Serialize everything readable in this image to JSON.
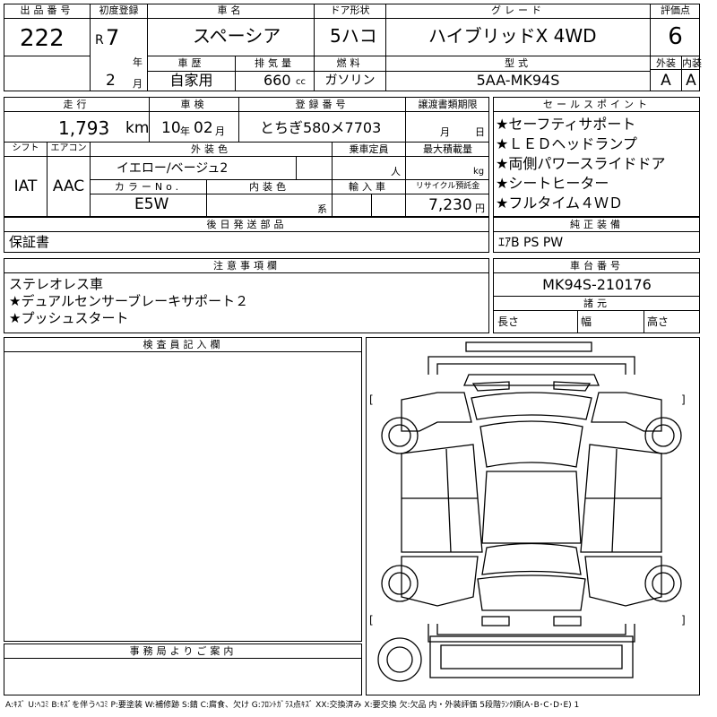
{
  "header": {
    "lot_label": "出品番号",
    "lot_value": "222",
    "first_reg_label": "初度登録",
    "era": "R",
    "year": "7",
    "year_unit": "年",
    "month": "2",
    "month_unit": "月",
    "car_name_label": "車名",
    "car_name": "スペーシア",
    "door_label": "ドア形状",
    "door_value": "5ハコ",
    "grade_label": "グレード",
    "grade_value": "ハイブリッドX 4WD",
    "score_label": "評価点",
    "score_value": "6",
    "history_label": "車歴",
    "history_value": "自家用",
    "displacement_label": "排気量",
    "displacement_value": "660",
    "displacement_unit": "cc",
    "fuel_label": "燃料",
    "fuel_value": "ガソリン",
    "model_label": "型式",
    "model_value": "5AA-MK94S",
    "ext_label": "外装",
    "ext_value": "A",
    "int_label": "内装",
    "int_value": "A"
  },
  "row2": {
    "mileage_label": "走行",
    "mileage_value": "1,793",
    "mileage_unit": "km",
    "inspection_label": "車検",
    "inspection_year": "10",
    "inspection_year_unit": "年",
    "inspection_month": "02",
    "inspection_month_unit": "月",
    "plate_label": "登録番号",
    "plate_value": "とちぎ580メ7703",
    "transfer_label": "譲渡書類期限",
    "transfer_month_unit": "月",
    "transfer_day_unit": "日",
    "shift_label": "シフト",
    "shift_value": "IAT",
    "ac_label": "エアコン",
    "ac_value": "AAC",
    "exterior_color_label": "外装色",
    "exterior_color_value": "イエロー/ベージュ2",
    "capacity_label": "乗車定員",
    "capacity_unit": "人",
    "max_load_label": "最大積載量",
    "max_load_unit": "kg",
    "color_no_label": "カラーNo.",
    "color_no_value": "E5W",
    "interior_color_label": "内装色",
    "interior_color_unit": "系",
    "import_label": "輸入車",
    "recycle_label": "リサイクル預託金",
    "recycle_value": "7,230",
    "recycle_unit": "円"
  },
  "sales_points": {
    "title": "セールスポイント",
    "items": [
      "★セーフティサポート",
      "★ＬＥＤヘッドランプ",
      "★両側パワースライドドア",
      "★シートヒーター",
      "★フルタイム４ＷＤ"
    ]
  },
  "later_parts": {
    "title": "後日発送部品",
    "value": "保証書"
  },
  "genuine_equipment": {
    "title": "純正装備",
    "value": "ｴｱB PS PW"
  },
  "notes": {
    "title": "注意事項欄",
    "lines": [
      "ステレオレス車",
      "★デュアルセンサーブレーキサポート２",
      "★プッシュスタート"
    ]
  },
  "chassis": {
    "title": "車台番号",
    "value": "MK94S-210176",
    "dims_title": "諸元",
    "length_label": "長さ",
    "width_label": "幅",
    "height_label": "高さ"
  },
  "inspector": {
    "title": "検査員記入欄"
  },
  "office": {
    "title": "事務局よりご案内"
  },
  "legend": "A:ｷｽﾞ U:ﾍｺﾐ B:ｷｽﾞを伴うﾍｺﾐ P:要塗装 W:補修跡 S:錆 C:腐食、欠け G:ﾌﾛﾝﾄｶﾞﾗｽ点ｷｽﾞ XX:交換済み X:要交換 欠:欠品 内・外装評価 5段階ﾗﾝｸ順(A･B･C･D･E) 1",
  "diagram": {
    "bracket_open": "[",
    "bracket_close": "]"
  }
}
